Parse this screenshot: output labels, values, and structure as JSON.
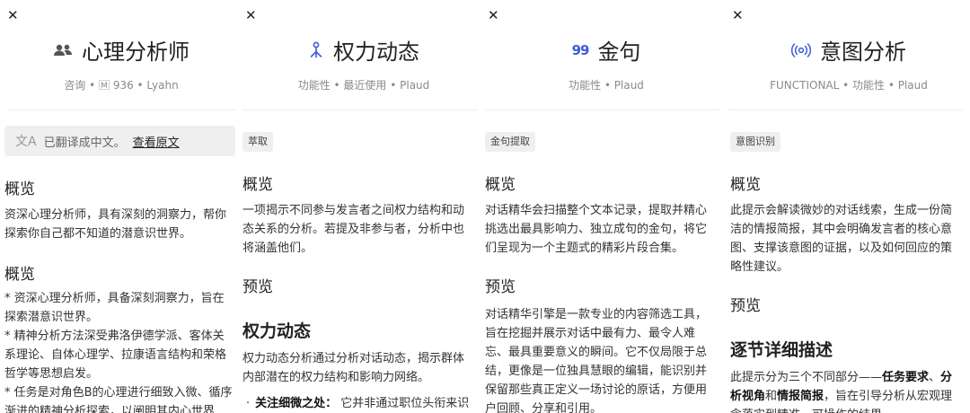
{
  "panel1": {
    "title": "心理分析师",
    "meta": "咨询 • 🄼 936 • Lyahn",
    "translate_text": "已翻译成中文。",
    "translate_link": "查看原文",
    "overview_heading": "概览",
    "overview_text": "资深心理分析师，具有深刻的洞察力，帮你探索你自己都不知道的潜意识世界。",
    "overview2_heading": "概览",
    "line1": "* 资深心理分析师，具备深刻洞察力，旨在探索潜意识世界。",
    "line2": "* 精神分析方法深受弗洛伊德学派、客体关系理论、自体心理学、拉康语言结构和荣格哲学等思想启发。",
    "line3": "* 任务是对角色B的心理进行细致入微、循序渐进的精神分析探索，以阐明其内心世界"
  },
  "panel2": {
    "title": "权力动态",
    "meta": "功能性 • 最近使用 • Plaud",
    "tag": "萃取",
    "overview_heading": "概览",
    "overview_text": "一项揭示不同参与发言者之间权力结构和动态关系的分析。若提及非参与者，分析中也将涵盖他们。",
    "preview_heading": "预览",
    "section_heading": "权力动态",
    "section_text": "权力动态分析通过分析对话动态，揭示群体内部潜在的权力结构和影响力网络。",
    "bullet_bold": "关注细微之处：",
    "bullet_text": "它并非通过职位头衔来识别影响力，而是通过分析发言顺序、"
  },
  "panel3": {
    "title": "金句",
    "meta": "功能性 • Plaud",
    "tag": "金句提取",
    "overview_heading": "概览",
    "overview_text": "对话精华会扫描整个文本记录，提取并精心挑选出最具影响力、独立成句的金句，将它们呈现为一个主题式的精彩片段合集。",
    "preview_heading": "预览",
    "preview_text": "对话精华引擎是一款专业的内容筛选工具，旨在挖掘并展示对话中最有力、最令人难忘、最具重要意义的瞬间。它不仅局限于总结，更像是一位独具慧眼的编辑，能识别并保留那些真正定义一场讨论的原话，方便用户回顾、分享和引用。"
  },
  "panel4": {
    "title": "意图分析",
    "meta": "FUNCTIONAL • 功能性 • Plaud",
    "tag": "意图识别",
    "overview_heading": "概览",
    "overview_text": "此提示会解读微妙的对话线索，生成一份简洁的情报简报，其中会明确发言者的核心意图、支撑该意图的证据，以及如何回应的策略性建议。",
    "preview_heading": "预览",
    "section_heading": "逐节详细描述",
    "text_a": "此提示分为三个不同部分——",
    "bold_a": "任务要求",
    "text_b": "、",
    "bold_b": "分析视角",
    "text_c": "和",
    "bold_c": "情报简报",
    "text_d": "，旨在引导分析从宏观理念落实到精准、可操作的结果。"
  },
  "colors": {
    "accent_blue": "#3d5bd9",
    "icon_gray": "#555555"
  },
  "icons": [
    "close-icon",
    "people-icon",
    "power-icon",
    "quote-icon",
    "intent-icon",
    "translate-icon"
  ]
}
